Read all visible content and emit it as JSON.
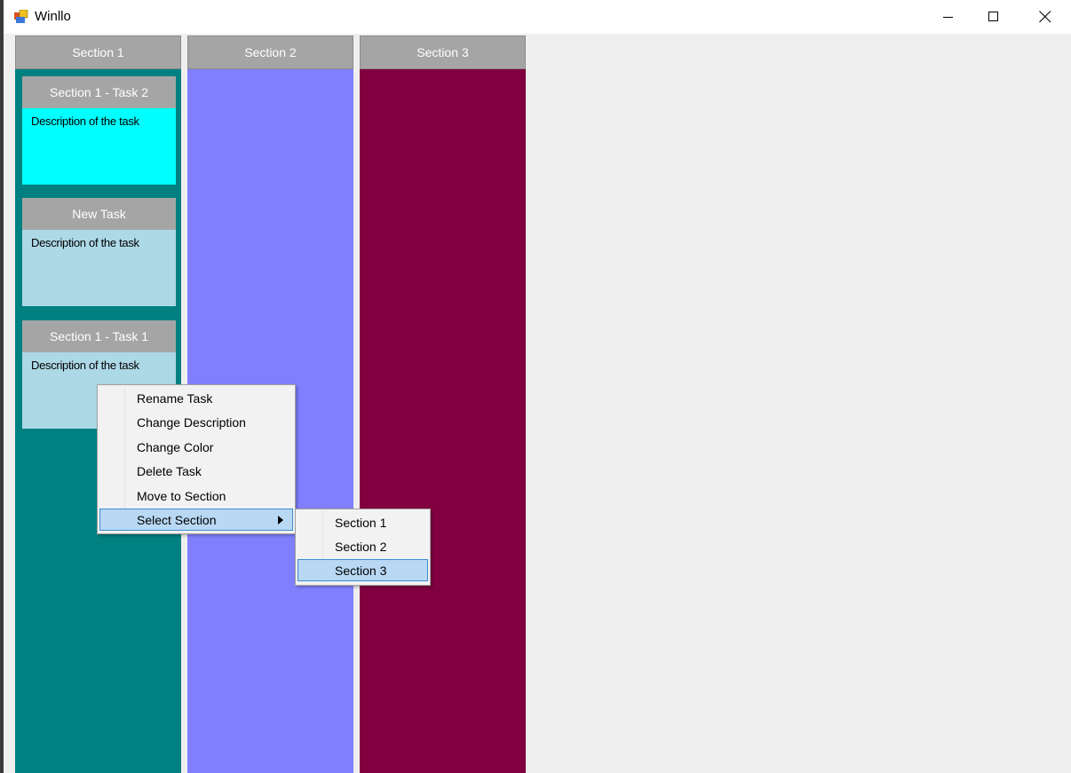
{
  "window": {
    "title": "Winllo"
  },
  "colors": {
    "section1": "#008080",
    "section2": "#8080ff",
    "section3": "#800040",
    "task_cyan": "#00ffff",
    "task_light": "#add8e6"
  },
  "sections": [
    {
      "title": "Section 1"
    },
    {
      "title": "Section 2"
    },
    {
      "title": "Section 3"
    }
  ],
  "tasks": [
    {
      "title": "Section 1 - Task 2",
      "description": "Description of the task"
    },
    {
      "title": "New Task",
      "description": "Description of the task"
    },
    {
      "title": "Section 1 - Task 1",
      "description": "Description of the task"
    }
  ],
  "context_menu": {
    "items": [
      "Rename Task",
      "Change Description",
      "Change Color",
      "Delete Task",
      "Move to Section",
      "Select Section"
    ],
    "highlighted": "Select Section"
  },
  "submenu": {
    "items": [
      "Section 1",
      "Section 2",
      "Section 3"
    ],
    "highlighted": "Section 3"
  }
}
